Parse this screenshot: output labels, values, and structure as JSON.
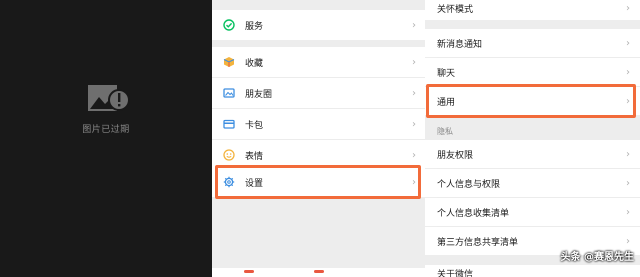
{
  "expired": {
    "label": "图片已过期"
  },
  "me_menu": {
    "items": [
      {
        "label": "服务",
        "icon": "service-icon"
      },
      {
        "label": "收藏",
        "icon": "favorites-icon"
      },
      {
        "label": "朋友圈",
        "icon": "moments-icon"
      },
      {
        "label": "卡包",
        "icon": "card-wallet-icon"
      },
      {
        "label": "表情",
        "icon": "emoji-icon"
      },
      {
        "label": "设置",
        "icon": "gear-icon"
      }
    ]
  },
  "settings": {
    "top_items": [
      "关怀模式",
      "新消息通知",
      "聊天",
      "通用"
    ],
    "privacy_section": "隐私",
    "privacy_items": [
      "朋友权限",
      "个人信息与权限",
      "个人信息收集清单",
      "第三方信息共享清单"
    ],
    "bottom_item": "关于微信"
  },
  "watermark": "头条 @赛恩先生",
  "colors": {
    "highlight": "#f26b3a",
    "accent_green": "#07c160"
  }
}
